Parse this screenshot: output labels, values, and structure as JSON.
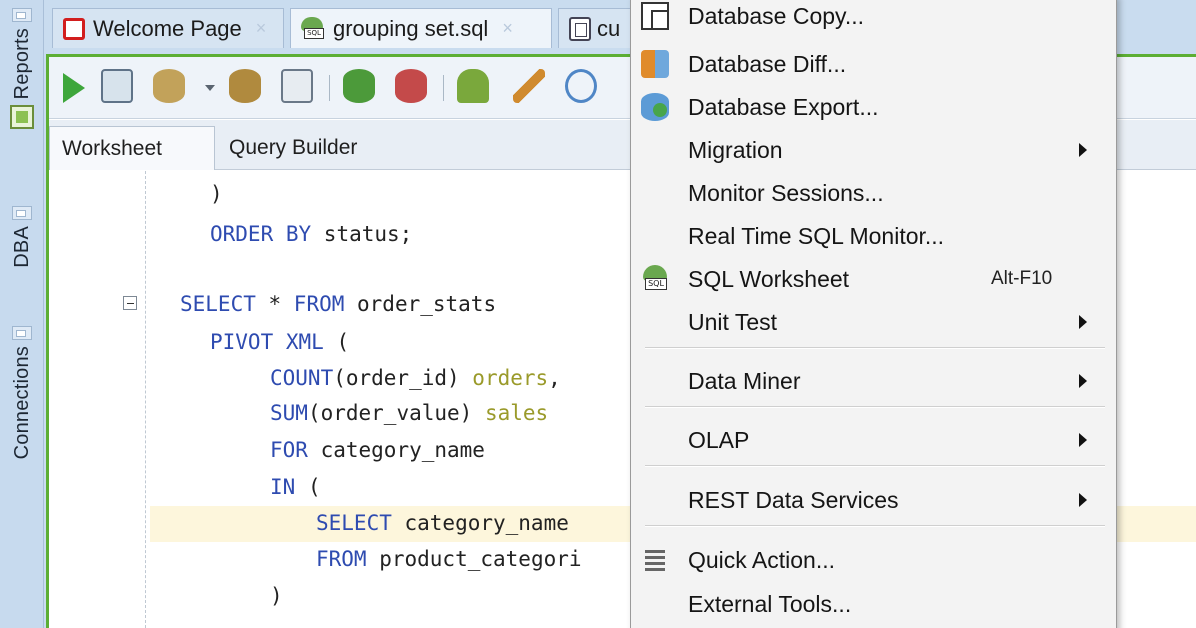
{
  "sidebar": {
    "tabs": [
      "Reports",
      "DBA",
      "Connections"
    ]
  },
  "tabs": [
    {
      "label": "Welcome Page",
      "icon": "oracle-icon"
    },
    {
      "label": "grouping set.sql",
      "icon": "sql-file-icon"
    },
    {
      "label": "cu",
      "icon": "database-icon"
    }
  ],
  "toolbar": {
    "icons": [
      "run-statement-icon",
      "run-script-icon",
      "commit-icon",
      "rollback-icon",
      "autotrace-icon",
      "explain-plan-icon",
      "sql-tuning-icon",
      "clear-icon",
      "sql-history-icon",
      "format-icon",
      "find-icon"
    ]
  },
  "subtabs": [
    "Worksheet",
    "Query Builder"
  ],
  "code": {
    "lines": [
      {
        "parts": [
          {
            "t": ")",
            "c": "id"
          }
        ]
      },
      {
        "parts": [
          {
            "t": "ORDER BY",
            "c": "kw"
          },
          {
            "t": " status;",
            "c": "id"
          }
        ]
      },
      {
        "parts": [
          {
            "t": "SELECT",
            "c": "kw"
          },
          {
            "t": " * ",
            "c": "id"
          },
          {
            "t": "FROM",
            "c": "kw"
          },
          {
            "t": " order_stats",
            "c": "id"
          }
        ]
      },
      {
        "parts": [
          {
            "t": "PIVOT XML",
            "c": "kw"
          },
          {
            "t": " (",
            "c": "id"
          }
        ]
      },
      {
        "parts": [
          {
            "t": "COUNT",
            "c": "kw"
          },
          {
            "t": "(order_id) ",
            "c": "id"
          },
          {
            "t": "orders",
            "c": "al"
          },
          {
            "t": ",",
            "c": "id"
          }
        ]
      },
      {
        "parts": [
          {
            "t": "SUM",
            "c": "kw"
          },
          {
            "t": "(order_value) ",
            "c": "id"
          },
          {
            "t": "sales",
            "c": "al"
          }
        ]
      },
      {
        "parts": [
          {
            "t": "FOR",
            "c": "kw"
          },
          {
            "t": " category_name",
            "c": "id"
          }
        ]
      },
      {
        "parts": [
          {
            "t": "IN",
            "c": "kw"
          },
          {
            "t": " (",
            "c": "id"
          }
        ]
      },
      {
        "parts": [
          {
            "t": "SELECT",
            "c": "kw"
          },
          {
            "t": " category_name",
            "c": "id"
          }
        ]
      },
      {
        "parts": [
          {
            "t": "FROM",
            "c": "kw"
          },
          {
            "t": " product_categori",
            "c": "id"
          }
        ]
      },
      {
        "parts": [
          {
            "t": ")",
            "c": "id"
          }
        ]
      }
    ]
  },
  "menu": {
    "items": [
      {
        "label": "Database Copy...",
        "icon": "database-copy-icon"
      },
      {
        "label": "Database Diff...",
        "icon": "database-diff-icon"
      },
      {
        "label": "Database Export...",
        "icon": "database-export-icon"
      },
      {
        "label": "Migration",
        "submenu": true
      },
      {
        "label": "Monitor Sessions..."
      },
      {
        "label": "Real Time SQL Monitor..."
      },
      {
        "label": "SQL Worksheet",
        "icon": "sql-worksheet-icon",
        "accelerator": "Alt-F10"
      },
      {
        "label": "Unit Test",
        "submenu": true
      },
      {
        "label": "Data Miner",
        "submenu": true
      },
      {
        "label": "OLAP",
        "submenu": true
      },
      {
        "label": "REST Data Services",
        "submenu": true
      },
      {
        "label": "Quick Action...",
        "icon": "quick-action-icon"
      },
      {
        "label": "External Tools..."
      }
    ]
  },
  "colors": {
    "accent_green": "#5cae34",
    "keyword_blue": "#2e4bb0",
    "alias_olive": "#9a9a2a",
    "tabbar_bg": "#c9dcef"
  }
}
